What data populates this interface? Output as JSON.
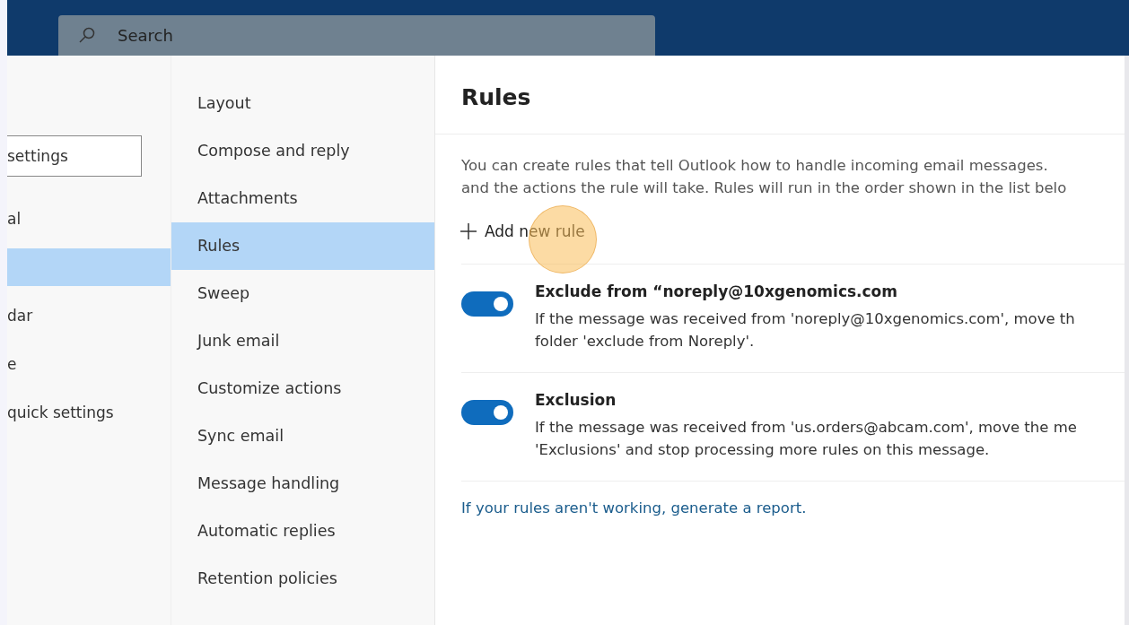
{
  "search": {
    "placeholder": "Search"
  },
  "settings_nav": {
    "search": {
      "placeholder": "settings"
    },
    "items": [
      {
        "label": "al",
        "selected": false
      },
      {
        "selected": true
      },
      {
        "label": "dar",
        "selected": false
      },
      {
        "label": "e",
        "selected": false
      },
      {
        "label": "quick settings",
        "selected": false
      }
    ]
  },
  "categories": [
    {
      "label": "Layout",
      "selected": false
    },
    {
      "label": "Compose and reply",
      "selected": false
    },
    {
      "label": "Attachments",
      "selected": false
    },
    {
      "label": "Rules",
      "selected": true
    },
    {
      "label": "Sweep",
      "selected": false
    },
    {
      "label": "Junk email",
      "selected": false
    },
    {
      "label": "Customize actions",
      "selected": false
    },
    {
      "label": "Sync email",
      "selected": false
    },
    {
      "label": "Message handling",
      "selected": false
    },
    {
      "label": "Automatic replies",
      "selected": false
    },
    {
      "label": "Retention policies",
      "selected": false
    }
  ],
  "panel": {
    "title": "Rules",
    "intro": [
      "You can create rules that tell Outlook how to handle incoming email messages.",
      "and the actions the rule will take. Rules will run in the order shown in the list belo"
    ],
    "add_button": "Add new rule",
    "click_highlight": true
  },
  "rules": [
    {
      "name": "Exclude from “noreply@10xgenomics.com",
      "on": true,
      "description": [
        "If the message was received from 'noreply@10xgenomics.com', move th",
        "folder 'exclude from Noreply'."
      ]
    },
    {
      "name": "Exclusion",
      "on": true,
      "description": [
        "If the message was received from 'us.orders@abcam.com', move the me",
        "'Exclusions' and stop processing more rules on this message."
      ]
    }
  ],
  "report_link": "If your rules aren't working, generate a report."
}
